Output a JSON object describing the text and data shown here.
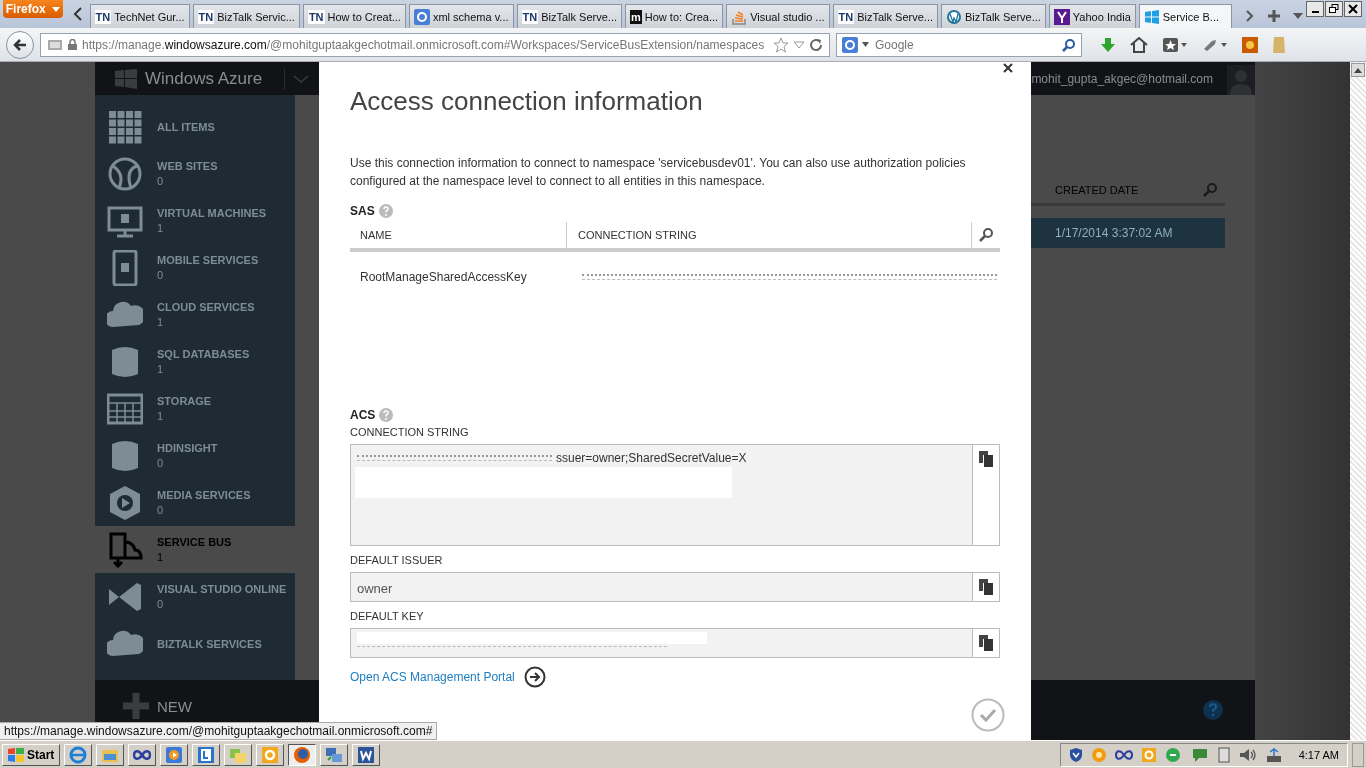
{
  "browser": {
    "menu_button": "Firefox",
    "tabs": [
      {
        "kind": "technet",
        "badge": "TN",
        "label": "TechNet Gur...",
        "selected": false
      },
      {
        "kind": "technet",
        "badge": "TN",
        "label": "BizTalk Servic...",
        "selected": false
      },
      {
        "kind": "technet",
        "badge": "TN",
        "label": "How to Creat...",
        "selected": false
      },
      {
        "kind": "google",
        "label": "xml schema v...",
        "selected": false
      },
      {
        "kind": "technet",
        "badge": "TN",
        "label": "BizTalk Serve...",
        "selected": false
      },
      {
        "kind": "msdn",
        "badge": "m",
        "label": "How to: Crea...",
        "selected": false
      },
      {
        "kind": "stack",
        "label": "Visual studio ...",
        "selected": false
      },
      {
        "kind": "technet",
        "badge": "TN",
        "label": "BizTalk Serve...",
        "selected": false
      },
      {
        "kind": "wordpress",
        "label": "BizTalk Serve...",
        "selected": false
      },
      {
        "kind": "yahoo",
        "label": "Yahoo India",
        "selected": false
      },
      {
        "kind": "windows",
        "label": "Service B...",
        "selected": true
      }
    ],
    "address": {
      "prefix": "https://manage.",
      "domain": "windowsazure.com",
      "rest": "/@mohitguptaakgechotmail.onmicrosoft.com#Workspaces/ServiceBusExtension/namespaces"
    },
    "search": {
      "placeholder": "Google"
    },
    "status_url": "https://manage.windowsazure.com/@mohitguptaakgechotmail.onmicrosoft.com#"
  },
  "portal": {
    "brand": "Windows Azure",
    "user": "mohit_gupta_akgec@hotmail.com",
    "sidebar": [
      {
        "kind": "grid",
        "label": "ALL ITEMS",
        "selected": false
      },
      {
        "kind": "globe",
        "label": "WEB SITES",
        "count": "0",
        "selected": false
      },
      {
        "kind": "monitor",
        "label": "VIRTUAL MACHINES",
        "count": "1",
        "selected": false
      },
      {
        "kind": "phone",
        "label": "MOBILE SERVICES",
        "count": "0",
        "selected": false
      },
      {
        "kind": "cloud",
        "label": "CLOUD SERVICES",
        "count": "1",
        "selected": false
      },
      {
        "kind": "db",
        "label": "SQL DATABASES",
        "count": "1",
        "selected": false
      },
      {
        "kind": "table",
        "label": "STORAGE",
        "count": "1",
        "selected": false
      },
      {
        "kind": "db",
        "label": "HDINSIGHT",
        "count": "0",
        "selected": false
      },
      {
        "kind": "play",
        "label": "MEDIA SERVICES",
        "count": "0",
        "selected": false
      },
      {
        "kind": "bus",
        "label": "SERVICE BUS",
        "count": "1",
        "selected": true
      },
      {
        "kind": "vs",
        "label": "VISUAL STUDIO ONLINE",
        "count": "0",
        "selected": false
      },
      {
        "kind": "cloud",
        "label": "BIZTALK SERVICES",
        "selected": false
      }
    ],
    "new_button": "NEW",
    "list": {
      "columns": [
        "CREATED DATE"
      ],
      "rows": [
        {
          "cells": [
            "1/17/2014 3:37:02 AM"
          ],
          "selected": true
        }
      ]
    }
  },
  "dialog": {
    "title": "Access connection information",
    "intro": "Use this connection information to connect to namespace 'servicebusdev01'. You can also use authorization policies configured at the namespace level to connect to all entities in this namespace.",
    "sas": {
      "heading": "SAS",
      "columns": [
        "NAME",
        "CONNECTION STRING"
      ],
      "rows": [
        {
          "name": "RootManageSharedAccessKey",
          "redacted": true
        }
      ]
    },
    "acs": {
      "heading": "ACS",
      "fields": [
        {
          "label": "CONNECTION STRING",
          "kind": "multiline",
          "value": "ssuer=owner;SharedSecretValue=X",
          "redacted": true
        },
        {
          "label": "DEFAULT ISSUER",
          "kind": "single",
          "value": "owner"
        },
        {
          "label": "DEFAULT KEY",
          "kind": "single",
          "redacted": true
        }
      ]
    },
    "link": "Open ACS Management Portal"
  },
  "taskbar": {
    "start": "Start",
    "apps": [
      {
        "kind": "ie",
        "selected": false
      },
      {
        "kind": "explorer",
        "selected": false
      },
      {
        "kind": "infinity",
        "selected": false
      },
      {
        "kind": "media",
        "selected": false
      },
      {
        "kind": "lync",
        "selected": false
      },
      {
        "kind": "photos",
        "selected": false
      },
      {
        "kind": "outlook",
        "selected": false
      },
      {
        "kind": "firefox",
        "selected": true
      },
      {
        "kind": "network",
        "selected": false
      },
      {
        "kind": "word",
        "selected": false
      }
    ],
    "time": "4:17 AM"
  }
}
